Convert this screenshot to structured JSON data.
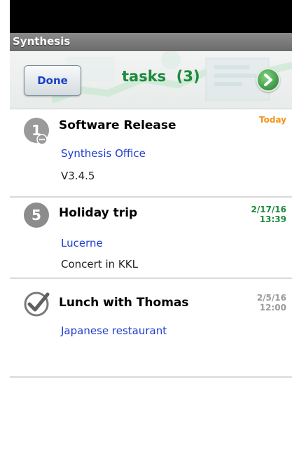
{
  "app": {
    "title": "Synthesis"
  },
  "header": {
    "done_label": "Done",
    "title": "tasks  (3)",
    "next_icon": "green-right-arrow-icon"
  },
  "tasks": [
    {
      "badge": "1",
      "icon": "priority-1-icon",
      "title": "Software Release",
      "location": "Synthesis Office",
      "note": "V3.4.5",
      "date": "Today",
      "date_color": "#f0961e"
    },
    {
      "badge": "5",
      "icon": "priority-5-icon",
      "title": "Holiday trip",
      "location": "Lucerne",
      "note": "Concert in KKL",
      "date_line1": "2/17/16",
      "date_line2": "13:39",
      "date_color": "#1e8a3c"
    },
    {
      "badge": "",
      "icon": "checkmark-done-icon",
      "title": "Lunch with Thomas",
      "location": "Japanese restaurant",
      "note": "",
      "date_line1": "2/5/16",
      "date_line2": "12:00",
      "date_color": "#9a9a9a"
    }
  ],
  "colors": {
    "accent_green": "#1e8a3c",
    "link_blue": "#1f3fcc",
    "today_orange": "#f0961e",
    "past_gray": "#9a9a9a"
  }
}
